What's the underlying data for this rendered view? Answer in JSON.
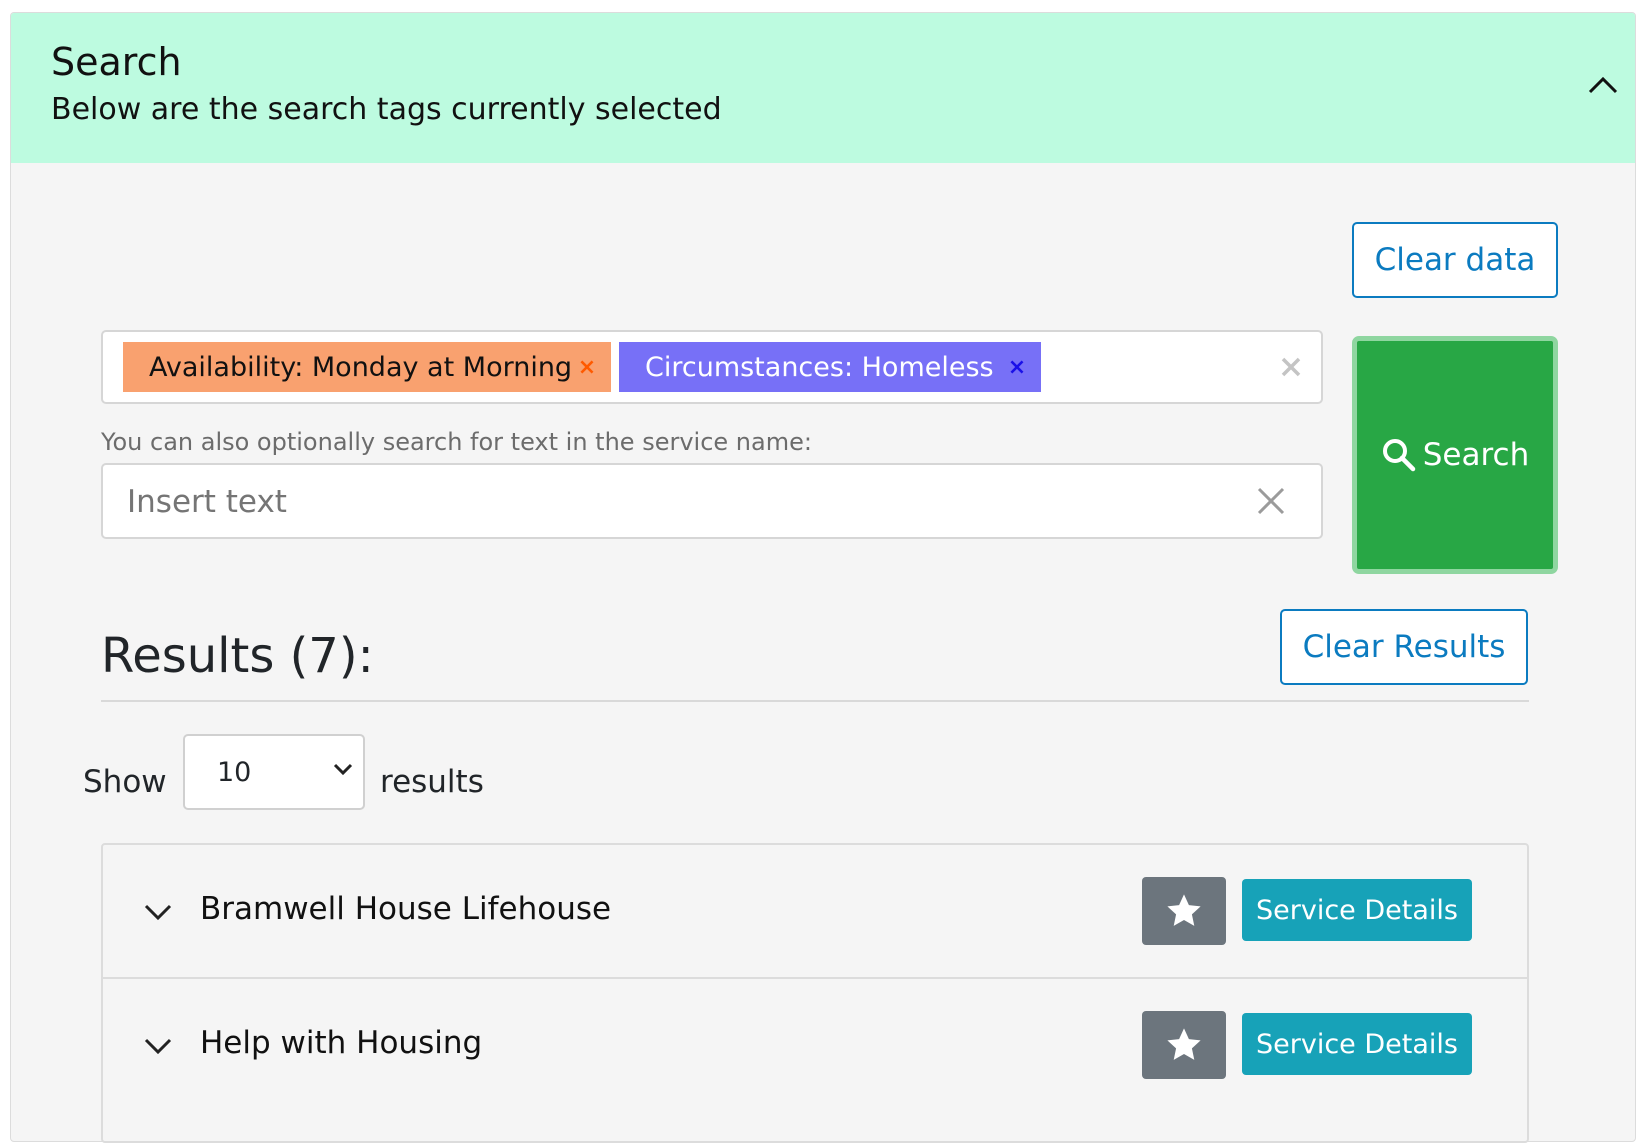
{
  "header": {
    "title": "Search",
    "subtitle": "Below are the search tags currently selected"
  },
  "actions": {
    "clear_data_label": "Clear data",
    "search_label": "Search",
    "clear_results_label": "Clear Results"
  },
  "tags": [
    {
      "label": "Availability: Monday at Morning",
      "remove": "×",
      "color": "#f9a16f"
    },
    {
      "label": "Circumstances: Homeless",
      "remove": "×",
      "color": "#7770f7"
    }
  ],
  "text_search": {
    "hint": "You can also optionally search for text in the service name:",
    "placeholder": "Insert text",
    "value": ""
  },
  "results": {
    "title": "Results (7):",
    "show_label": "Show",
    "page_size": "10",
    "results_label": "results",
    "items": [
      {
        "name": "Bramwell House Lifehouse",
        "details_label": "Service Details"
      },
      {
        "name": "Help with Housing",
        "details_label": "Service Details"
      }
    ]
  },
  "colors": {
    "header_bg": "#bdfbe0",
    "search_button": "#28a745",
    "details_button": "#17a2b8",
    "star_button": "#6c757d",
    "link_blue": "#0b7bc0"
  },
  "icons": {
    "collapse": "chevron-up-icon",
    "search": "search-icon",
    "star": "star-icon",
    "expand": "chevron-down-icon",
    "clear": "close-icon"
  }
}
